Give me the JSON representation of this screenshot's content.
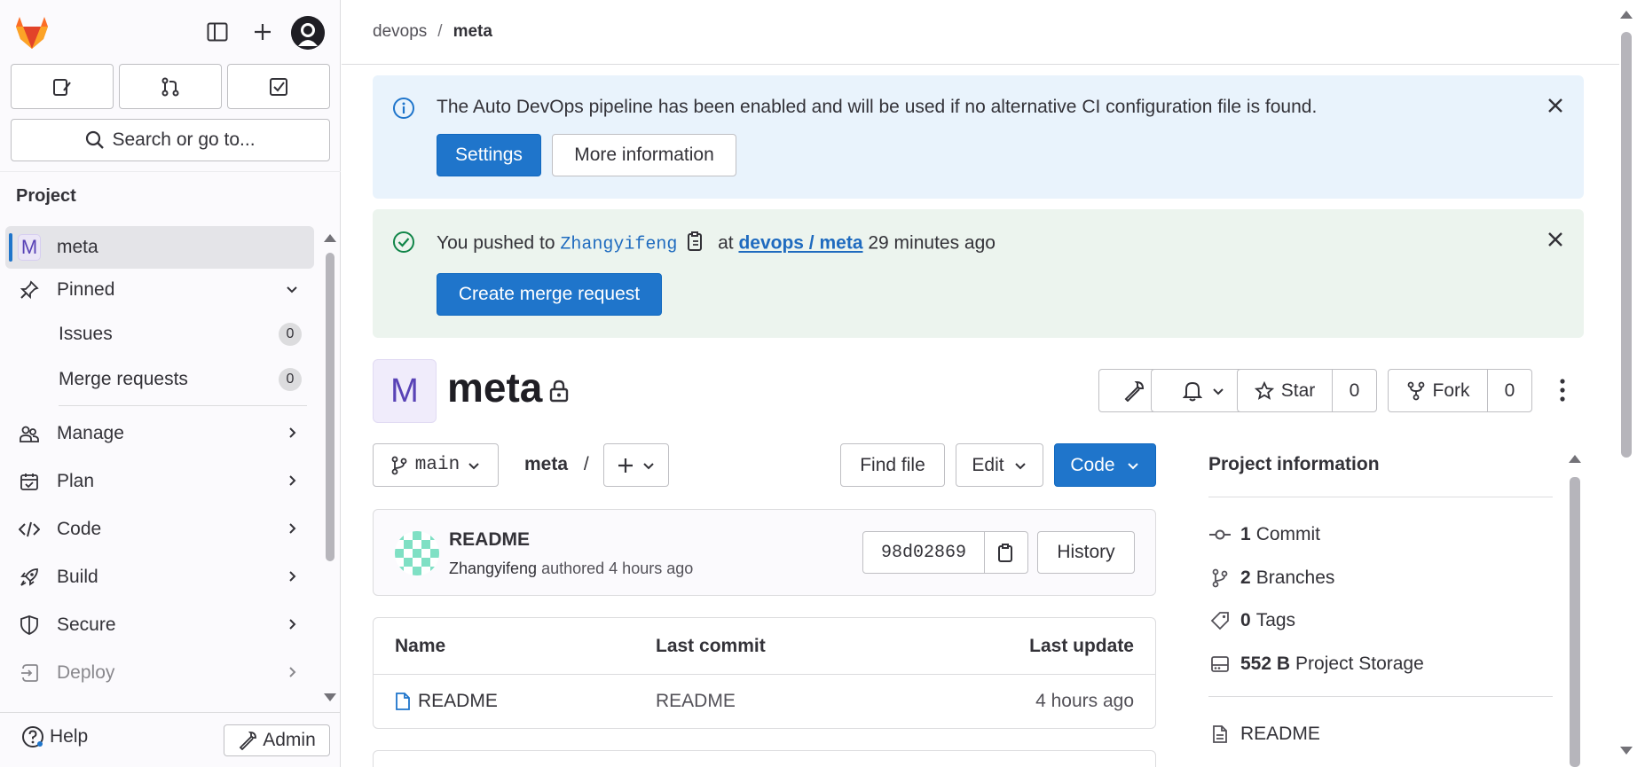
{
  "sidebar": {
    "search_placeholder": "Search or go to...",
    "section_title": "Project",
    "project_initial": "M",
    "project_name": "meta",
    "pinned_label": "Pinned",
    "pinned_items": [
      {
        "label": "Issues",
        "count": "0"
      },
      {
        "label": "Merge requests",
        "count": "0"
      }
    ],
    "nav": [
      "Manage",
      "Plan",
      "Code",
      "Build",
      "Secure",
      "Deploy"
    ],
    "help_label": "Help",
    "admin_label": "Admin"
  },
  "breadcrumb": {
    "group": "devops",
    "sep": "/",
    "project": "meta"
  },
  "alert_info": {
    "text": "The Auto DevOps pipeline has been enabled and will be used if no alternative CI configuration file is found.",
    "settings_label": "Settings",
    "more_label": "More information"
  },
  "alert_push": {
    "prefix": "You pushed to",
    "branch": "Zhangyifeng",
    "at": "at",
    "project_link": "devops / meta",
    "time": "29 minutes ago",
    "create_mr_label": "Create merge request"
  },
  "project": {
    "initial": "M",
    "name": "meta",
    "star_label": "Star",
    "star_count": "0",
    "fork_label": "Fork",
    "fork_count": "0"
  },
  "repo": {
    "branch": "main",
    "path": "meta",
    "path_sep": "/",
    "find_file": "Find file",
    "edit": "Edit",
    "code": "Code"
  },
  "last_commit": {
    "title": "README",
    "author": "Zhangyifeng",
    "authored": "authored",
    "time": "4 hours ago",
    "sha": "98d02869",
    "history_label": "History"
  },
  "files": {
    "headers": [
      "Name",
      "Last commit",
      "Last update"
    ],
    "rows": [
      {
        "name": "README",
        "commit": "README",
        "updated": "4 hours ago"
      }
    ]
  },
  "project_info": {
    "title": "Project information",
    "stats": [
      {
        "value": "1",
        "label": "Commit",
        "icon": "commit-icon"
      },
      {
        "value": "2",
        "label": "Branches",
        "icon": "branch-icon"
      },
      {
        "value": "0",
        "label": "Tags",
        "icon": "tag-icon"
      },
      {
        "value": "552 B",
        "label": "Project Storage",
        "icon": "storage-icon"
      }
    ],
    "readme": "README"
  },
  "colors": {
    "primary": "#1f75cb",
    "info_bg": "#e9f3fc",
    "success_bg": "#ecf4ee",
    "brand_orange": "#e24329"
  }
}
